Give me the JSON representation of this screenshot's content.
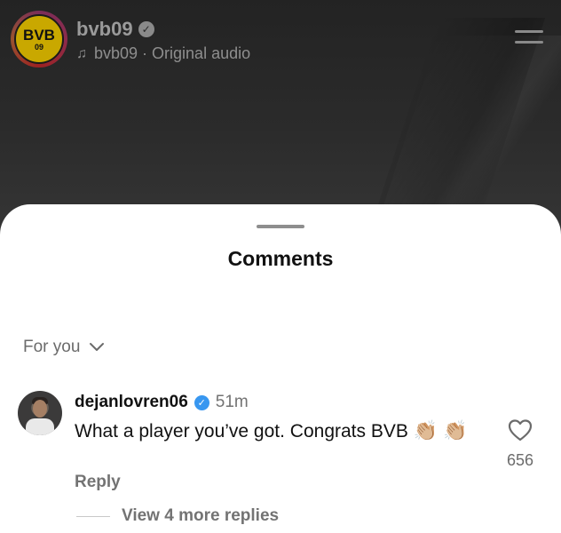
{
  "reel": {
    "account_name": "bvb09",
    "audio_label": "bvb09 · Original audio",
    "logo_text_top": "BVB",
    "logo_text_bottom": "09"
  },
  "sheet": {
    "title": "Comments",
    "filter_label": "For you"
  },
  "comment": {
    "username": "dejanlovren06",
    "time": "51m",
    "text": "What a player you’ve got. Congrats BVB",
    "emoji": "👏🏼",
    "reply_label": "Reply",
    "like_count": "656",
    "view_replies_label": "View 4 more replies"
  },
  "colors": {
    "sheet_background": "#ffffff",
    "verified_badge": "#3897f0",
    "secondary_text": "#737373",
    "bvb_yellow": "#c9a800"
  },
  "icons": [
    "music-note-icon",
    "verified-icon",
    "menu-icon",
    "chevron-down-icon",
    "heart-icon"
  ]
}
